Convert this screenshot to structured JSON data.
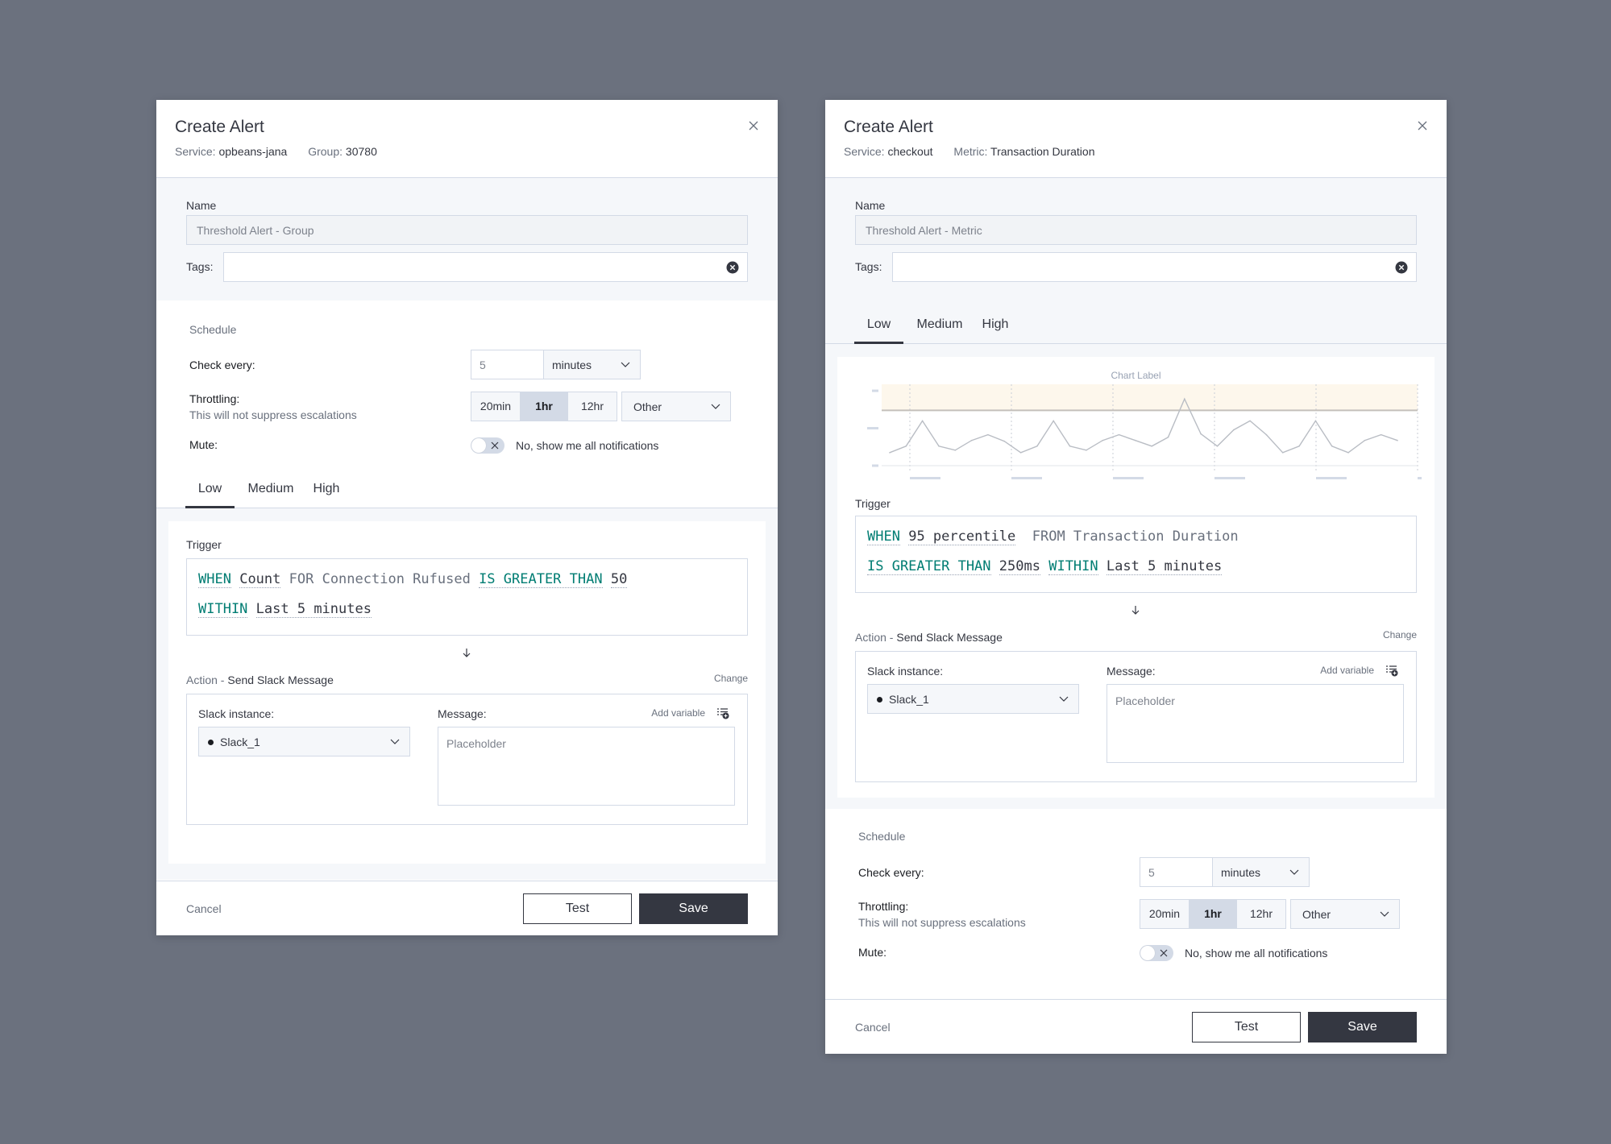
{
  "colors": {
    "background": "#6b717e",
    "keyword": "#017d73",
    "primary_button": "#343741",
    "threshold_band": "#fdf7ec",
    "line": "#b9bdc4"
  },
  "dialogs": [
    {
      "title": "Create Alert",
      "meta": [
        {
          "label": "Service:",
          "value": "opbeans-jana"
        },
        {
          "label": "Group:",
          "value": "30780"
        }
      ],
      "name_label": "Name",
      "name_value": "Threshold Alert - Group",
      "tags_label": "Tags:",
      "tags_value": "",
      "schedule": {
        "title": "Schedule",
        "check_every_label": "Check every:",
        "check_every_value": "5",
        "check_every_unit": "minutes",
        "throttling_label": "Throttling:",
        "throttling_sub": "This will not suppress escalations",
        "throttling_options": [
          "20min",
          "1hr",
          "12hr"
        ],
        "throttling_selected": "1hr",
        "throttling_other": "Other",
        "mute_label": "Mute:",
        "mute_on": false,
        "mute_text": "No, show me all notifications"
      },
      "tabs": [
        "Low",
        "Medium",
        "High"
      ],
      "active_tab": "Low",
      "trigger": {
        "label": "Trigger",
        "line1": [
          {
            "t": "WHEN",
            "k": "kw"
          },
          {
            "t": " Count",
            "k": "val"
          },
          {
            "t": " FOR Connection Rufused",
            "k": "dim"
          },
          {
            "t": " IS GREATER THAN",
            "k": "kw"
          },
          {
            "t": " 50",
            "k": "val"
          }
        ],
        "line2": [
          {
            "t": "WITHIN",
            "k": "kw"
          },
          {
            "t": " Last 5 minutes",
            "k": "val"
          }
        ]
      },
      "action": {
        "label_prefix": "Action - ",
        "label_value": "Send Slack Message",
        "change": "Change",
        "slack_label": "Slack instance:",
        "slack_value": "Slack_1",
        "message_label": "Message:",
        "add_variable": "Add variable",
        "message_placeholder": "Placeholder"
      },
      "footer": {
        "cancel": "Cancel",
        "test": "Test",
        "save": "Save"
      }
    },
    {
      "title": "Create Alert",
      "meta": [
        {
          "label": "Service:",
          "value": "checkout"
        },
        {
          "label": "Metric:",
          "value": "Transaction Duration"
        }
      ],
      "name_label": "Name",
      "name_value": "Threshold Alert - Metric",
      "tags_label": "Tags:",
      "tags_value": "",
      "tabs": [
        "Low",
        "Medium",
        "High"
      ],
      "active_tab": "Low",
      "trigger": {
        "label": "Trigger",
        "line1": [
          {
            "t": "WHEN",
            "k": "kw"
          },
          {
            "t": " 95 percentile",
            "k": "val"
          },
          {
            "t": "  FROM Transaction Duration",
            "k": "dim"
          }
        ],
        "line2": [
          {
            "t": "IS GREATER THAN",
            "k": "kw"
          },
          {
            "t": " 250ms",
            "k": "val"
          },
          {
            "t": " WITHIN",
            "k": "kw"
          },
          {
            "t": " Last 5 minutes",
            "k": "val"
          }
        ]
      },
      "action": {
        "label_prefix": "Action - ",
        "label_value": "Send Slack Message",
        "change": "Change",
        "slack_label": "Slack instance:",
        "slack_value": "Slack_1",
        "message_label": "Message:",
        "add_variable": "Add variable",
        "message_placeholder": "Placeholder"
      },
      "schedule": {
        "title": "Schedule",
        "check_every_label": "Check every:",
        "check_every_value": "5",
        "check_every_unit": "minutes",
        "throttling_label": "Throttling:",
        "throttling_sub": "This will not suppress escalations",
        "throttling_options": [
          "20min",
          "1hr",
          "12hr"
        ],
        "throttling_selected": "1hr",
        "throttling_other": "Other",
        "mute_label": "Mute:",
        "mute_on": false,
        "mute_text": "No, show me all notifications"
      },
      "footer": {
        "cancel": "Cancel",
        "test": "Test",
        "save": "Save"
      }
    }
  ],
  "chart_data": {
    "type": "line",
    "title": "Chart Label",
    "xlabel": "",
    "ylabel": "",
    "x_tick_labels": [
      "",
      "",
      "",
      "",
      "",
      ""
    ],
    "y_tick_labels": [
      "",
      "",
      ""
    ],
    "y_ticks": [
      0,
      46,
      92
    ],
    "ylim": [
      0,
      100
    ],
    "grid": "vertical-dashed",
    "threshold": 68,
    "threshold_band": [
      68,
      100
    ],
    "series": [
      {
        "name": "metric",
        "values": [
          16,
          24,
          55,
          24,
          19,
          31,
          38,
          30,
          16,
          24,
          55,
          24,
          19,
          31,
          38,
          31,
          24,
          35,
          82,
          39,
          24,
          44,
          55,
          38,
          16,
          24,
          55,
          24,
          16,
          31,
          38,
          31
        ]
      }
    ]
  }
}
